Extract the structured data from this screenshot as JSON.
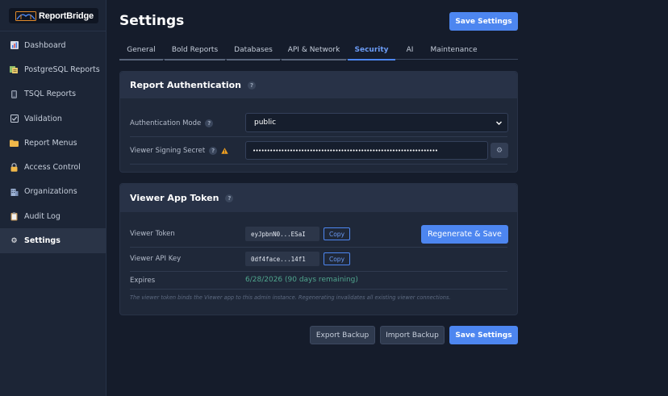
{
  "app": {
    "name": "ReportBridge"
  },
  "sidebar": {
    "items": [
      {
        "label": "Dashboard",
        "icon": "bar-chart-icon"
      },
      {
        "label": "PostgreSQL Reports",
        "icon": "reports-icon"
      },
      {
        "label": "TSQL Reports",
        "icon": "phone-icon"
      },
      {
        "label": "Validation",
        "icon": "checkbox-icon"
      },
      {
        "label": "Report Menus",
        "icon": "folder-icon"
      },
      {
        "label": "Access Control",
        "icon": "lock-icon"
      },
      {
        "label": "Organizations",
        "icon": "building-icon"
      },
      {
        "label": "Audit Log",
        "icon": "clipboard-icon"
      },
      {
        "label": "Settings",
        "icon": "gear-icon",
        "active": true
      }
    ]
  },
  "header": {
    "title": "Settings",
    "save_label": "Save Settings"
  },
  "tabs": [
    {
      "label": "General"
    },
    {
      "label": "Bold Reports"
    },
    {
      "label": "Databases"
    },
    {
      "label": "API & Network"
    },
    {
      "label": "Security",
      "active": true
    },
    {
      "label": "AI"
    },
    {
      "label": "Maintenance"
    }
  ],
  "auth": {
    "title": "Report Authentication",
    "mode_label": "Authentication Mode",
    "mode_value": "public",
    "secret_label": "Viewer Signing Secret",
    "secret_value": "•••••••••••••••••••••••••••••••••••••••••••••••••••••••••••••••••"
  },
  "token": {
    "title": "Viewer App Token",
    "viewer_token_label": "Viewer Token",
    "viewer_token_value": "eyJpbnN0...ESaI",
    "copy_label": "Copy",
    "regenerate_label": "Regenerate & Save",
    "api_key_label": "Viewer API Key",
    "api_key_value": "0df4face...14f1",
    "expires_label": "Expires",
    "expires_value": "6/28/2026 (90 days remaining)",
    "note": "The viewer token binds the Viewer app to this admin instance. Regenerating invalidates all existing viewer connections."
  },
  "footer": {
    "export_label": "Export Backup",
    "import_label": "Import Backup",
    "save_label": "Save Settings"
  },
  "colors": {
    "accent": "#4d86f0",
    "background": "#151c2b",
    "sidebar": "#1c2536",
    "success_text": "#4fa58d",
    "warning": "#f0a020"
  }
}
